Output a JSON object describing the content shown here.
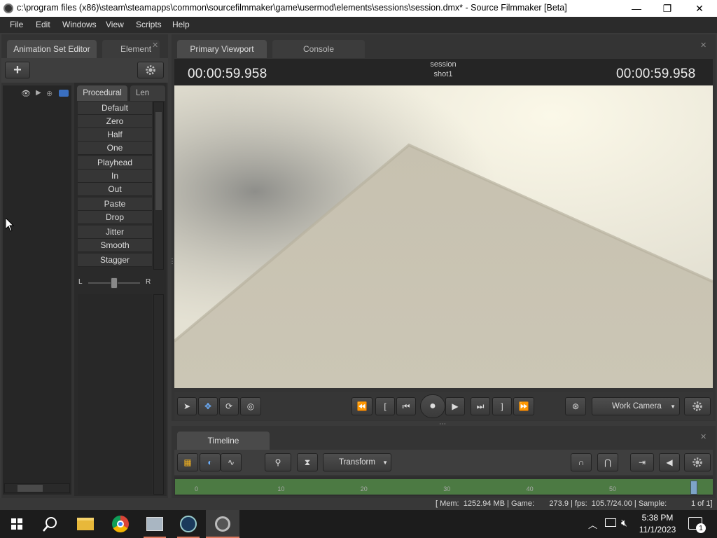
{
  "window": {
    "title": "c:\\program files (x86)\\steam\\steamapps\\common\\sourcefilmmaker\\game\\usermod\\elements\\sessions\\session.dmx* - Source Filmmaker [Beta]",
    "minimize": "—",
    "restore": "❐",
    "close": "✕"
  },
  "menu": {
    "file": "File",
    "edit": "Edit",
    "windows": "Windows",
    "view": "View",
    "scripts": "Scripts",
    "help": "Help"
  },
  "left_panel": {
    "tab_animation": "Animation Set Editor",
    "tab_element": "Element",
    "add_label": "+",
    "subtab_procedural": "Procedural",
    "subtab_lens": "Len",
    "buttons": [
      "Default",
      "Zero",
      "Half",
      "One",
      "Playhead",
      "In",
      "Out",
      "Paste",
      "Drop",
      "Jitter",
      "Smooth",
      "Stagger"
    ],
    "slider_left": "L",
    "slider_right": "R",
    "slider_value": 0.5
  },
  "viewport_panel": {
    "tab_primary": "Primary Viewport",
    "tab_console": "Console",
    "timecode_left": "00:00:59.958",
    "timecode_right": "00:00:59.958",
    "session": "session",
    "shot": "shot1",
    "camera": "Work Camera"
  },
  "timeline_panel": {
    "tab": "Timeline",
    "mode": "Transform",
    "ticks": [
      "0",
      "10",
      "20",
      "30",
      "40",
      "50"
    ]
  },
  "statusbar": {
    "text": "[ Mem:  1252.94 MB | Game:       273.9 | fps:  105.7/24.00 | Sample:",
    "sample": "1 of 1]"
  },
  "taskbar": {
    "time": "5:38 PM",
    "date": "11/1/2023",
    "notif_count": "1"
  },
  "colors": {
    "accent_blue": "#1e90ff",
    "timeline_green": "#4c7a43"
  }
}
